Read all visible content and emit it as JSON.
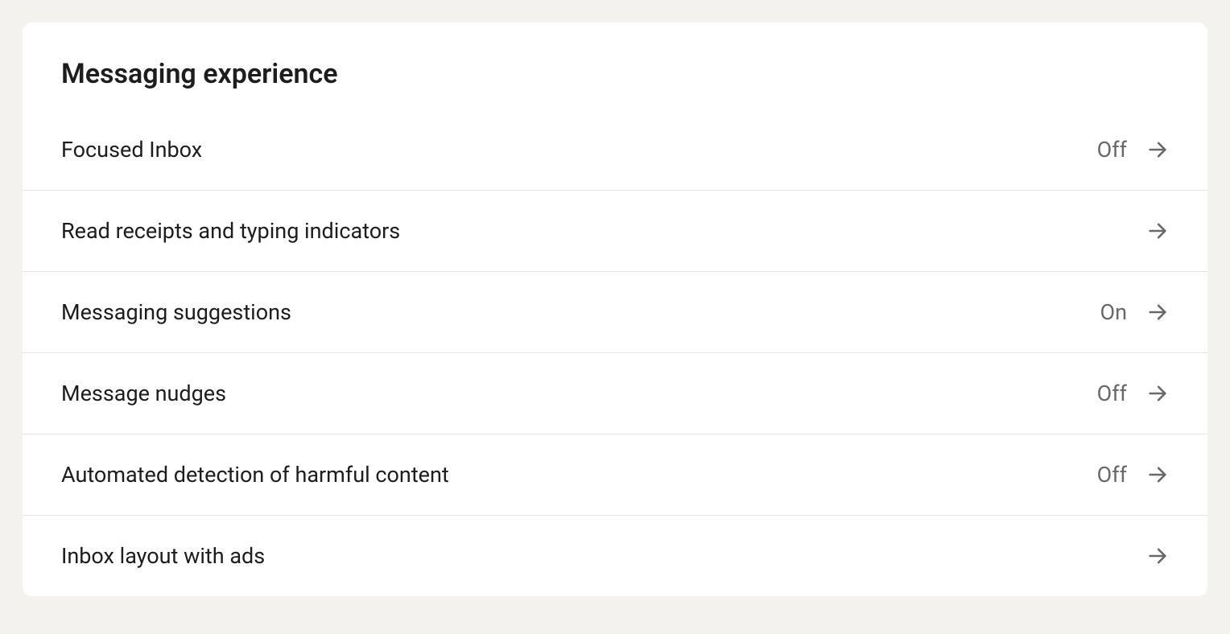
{
  "section": {
    "title": "Messaging experience",
    "items": [
      {
        "label": "Focused Inbox",
        "status": "Off"
      },
      {
        "label": "Read receipts and typing indicators",
        "status": ""
      },
      {
        "label": "Messaging suggestions",
        "status": "On"
      },
      {
        "label": "Message nudges",
        "status": "Off"
      },
      {
        "label": "Automated detection of harmful content",
        "status": "Off"
      },
      {
        "label": "Inbox layout with ads",
        "status": ""
      }
    ]
  }
}
